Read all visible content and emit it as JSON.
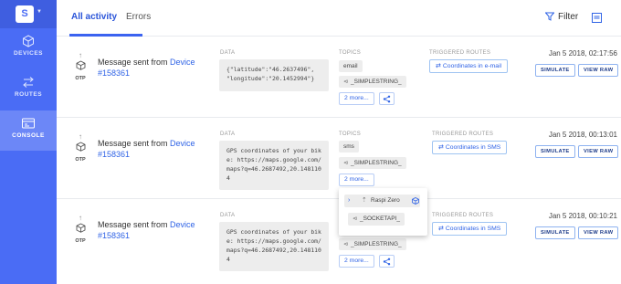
{
  "sidebar": {
    "logo_letter": "S",
    "items": [
      {
        "label": "DEVICES",
        "icon": "cube-icon"
      },
      {
        "label": "ROUTES",
        "icon": "routes-arrows-icon"
      },
      {
        "label": "CONSOLE",
        "icon": "console-icon"
      }
    ],
    "active": "CONSOLE"
  },
  "header": {
    "tabs": [
      {
        "label": "All activity",
        "active": true
      },
      {
        "label": "Errors",
        "active": false
      }
    ],
    "filter_label": "Filter"
  },
  "labels": {
    "data": "DATA",
    "topics": "TOPICS",
    "triggered_routes": "TRIGGERED ROUTES",
    "simulate": "SIMULATE",
    "view_raw": "VIEW RAW",
    "device_protocol": "OTP"
  },
  "rows": [
    {
      "message_prefix": "Message sent from",
      "device_name": "Device",
      "device_id": "#158361",
      "data": "{\"latitude\":\"46.2637496\",\n\"longitude\":\"20.1452994\"}",
      "topics": [
        "email",
        "_SIMPLESTRING_"
      ],
      "more_label": "2 more...",
      "route": "Coordinates in e-mail",
      "timestamp": "Jan 5 2018, 02:17:56"
    },
    {
      "message_prefix": "Message sent from",
      "device_name": "Device",
      "device_id": "#158361",
      "data": "GPS coordinates of your bike: https://maps.google.com/maps?q=46.2687492,20.1481104",
      "topics": [
        "sms",
        "_SIMPLESTRING_"
      ],
      "more_label": "2 more...",
      "route": "Coordinates in SMS",
      "timestamp": "Jan 5 2018, 00:13:01"
    },
    {
      "message_prefix": "Message sent from",
      "device_name": "Device",
      "device_id": "#158361",
      "data": "GPS coordinates of your bike: https://maps.google.com/maps?q=46.2687492,20.1481104",
      "topics": [
        "_SIMPLESTRING_"
      ],
      "more_label": "2 more...",
      "route": "Coordinates in SMS",
      "timestamp": "Jan 5 2018, 00:10:21"
    }
  ],
  "popup": {
    "device_label": "Raspi Zero",
    "topic": "_SOCKETAPI_"
  },
  "colors": {
    "sidebar": "#4a6cf5",
    "sidebar_active": "#6c87f7",
    "accent": "#2f63e6"
  }
}
